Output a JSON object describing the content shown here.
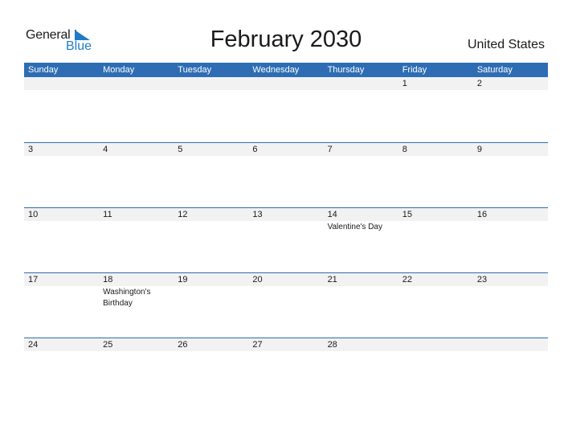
{
  "logo": {
    "line1": "General",
    "line2": "Blue",
    "icon": "flag-triangle-icon",
    "accent_color": "#1f7bc9"
  },
  "title": "February 2030",
  "country": "United States",
  "colors": {
    "header_bg": "#2e6db4",
    "strip_bg": "#f2f2f2"
  },
  "weekdays": [
    "Sunday",
    "Monday",
    "Tuesday",
    "Wednesday",
    "Thursday",
    "Friday",
    "Saturday"
  ],
  "weeks": [
    [
      {
        "day": "",
        "holiday": ""
      },
      {
        "day": "",
        "holiday": ""
      },
      {
        "day": "",
        "holiday": ""
      },
      {
        "day": "",
        "holiday": ""
      },
      {
        "day": "",
        "holiday": ""
      },
      {
        "day": "1",
        "holiday": ""
      },
      {
        "day": "2",
        "holiday": ""
      }
    ],
    [
      {
        "day": "3",
        "holiday": ""
      },
      {
        "day": "4",
        "holiday": ""
      },
      {
        "day": "5",
        "holiday": ""
      },
      {
        "day": "6",
        "holiday": ""
      },
      {
        "day": "7",
        "holiday": ""
      },
      {
        "day": "8",
        "holiday": ""
      },
      {
        "day": "9",
        "holiday": ""
      }
    ],
    [
      {
        "day": "10",
        "holiday": ""
      },
      {
        "day": "11",
        "holiday": ""
      },
      {
        "day": "12",
        "holiday": ""
      },
      {
        "day": "13",
        "holiday": ""
      },
      {
        "day": "14",
        "holiday": "Valentine's Day"
      },
      {
        "day": "15",
        "holiday": ""
      },
      {
        "day": "16",
        "holiday": ""
      }
    ],
    [
      {
        "day": "17",
        "holiday": ""
      },
      {
        "day": "18",
        "holiday": "Washington's Birthday"
      },
      {
        "day": "19",
        "holiday": ""
      },
      {
        "day": "20",
        "holiday": ""
      },
      {
        "day": "21",
        "holiday": ""
      },
      {
        "day": "22",
        "holiday": ""
      },
      {
        "day": "23",
        "holiday": ""
      }
    ],
    [
      {
        "day": "24",
        "holiday": ""
      },
      {
        "day": "25",
        "holiday": ""
      },
      {
        "day": "26",
        "holiday": ""
      },
      {
        "day": "27",
        "holiday": ""
      },
      {
        "day": "28",
        "holiday": ""
      },
      {
        "day": "",
        "holiday": ""
      },
      {
        "day": "",
        "holiday": ""
      }
    ]
  ]
}
